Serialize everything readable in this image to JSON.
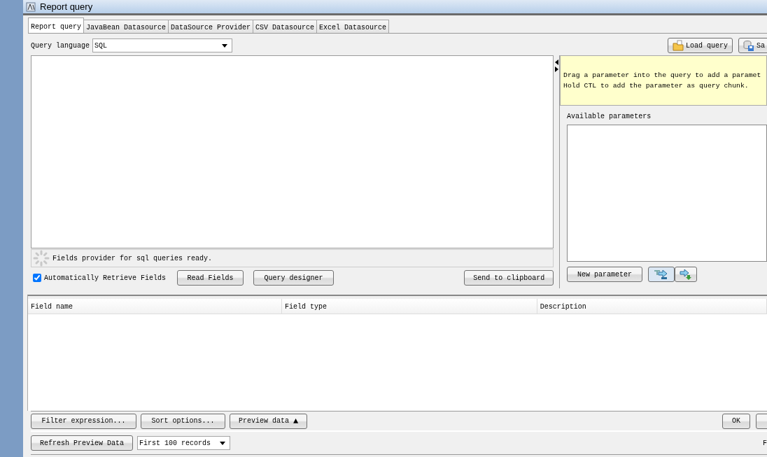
{
  "window": {
    "title": "Report query"
  },
  "tabs": [
    {
      "label": "Report query",
      "selected": true
    },
    {
      "label": "JavaBean Datasource",
      "selected": false
    },
    {
      "label": "DataSource Provider",
      "selected": false
    },
    {
      "label": "CSV Datasource",
      "selected": false
    },
    {
      "label": "Excel Datasource",
      "selected": false
    }
  ],
  "query_language": {
    "label": "Query language",
    "value": "SQL"
  },
  "toolbar_buttons": [
    {
      "label": "Load query",
      "kind": "load"
    },
    {
      "label": "Sa",
      "kind": "save"
    }
  ],
  "query_editor": {
    "status": "Fields provider for sql queries ready.",
    "auto_retrieve": {
      "label": "Automatically Retrieve Fields",
      "checked": true
    },
    "buttons": [
      "Read Fields",
      "Query designer"
    ],
    "clipboard_button": "Send to clipboard"
  },
  "parameters_panel": {
    "hint": [
      "Drag a parameter into the query to add a paramet",
      "Hold CTL to add the parameter as query chunk."
    ],
    "available_label": "Available parameters",
    "new_parameter_button": "New parameter"
  },
  "fields_table": {
    "columns": [
      "Field name",
      "Field type",
      "Description"
    ]
  },
  "data_buttons": [
    "Filter expression...",
    "Sort options..."
  ],
  "preview_button": {
    "label": "Preview data",
    "glyph": "▲"
  },
  "dialog_buttons": [
    "OK"
  ],
  "preview_bar": {
    "refresh_button": "Refresh Preview Data",
    "limit": "First 100 records",
    "edge_text": "F"
  }
}
